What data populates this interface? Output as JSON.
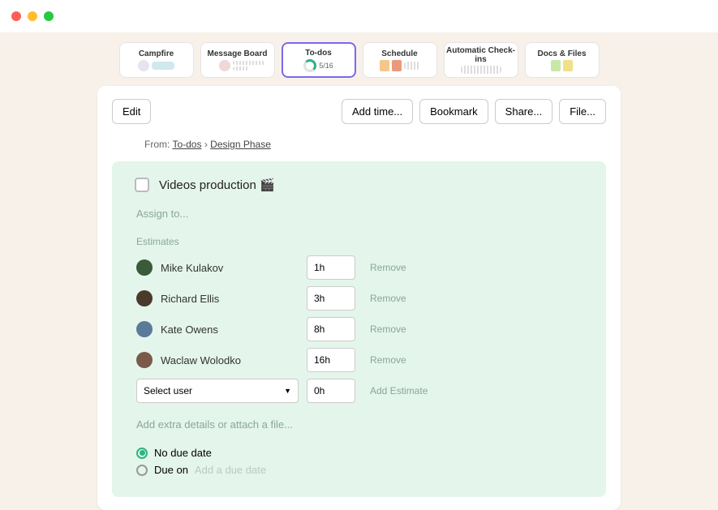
{
  "nav": {
    "tabs": [
      {
        "label": "Campfire"
      },
      {
        "label": "Message Board"
      },
      {
        "label": "To-dos",
        "count": "5/16",
        "active": true
      },
      {
        "label": "Schedule"
      },
      {
        "label": "Automatic Check-ins"
      },
      {
        "label": "Docs & Files"
      }
    ]
  },
  "toolbar": {
    "edit": "Edit",
    "add_time": "Add time...",
    "bookmark": "Bookmark",
    "share": "Share...",
    "file": "File..."
  },
  "breadcrumb": {
    "from": "From: ",
    "link1": "To-dos",
    "sep": " › ",
    "link2": "Design Phase"
  },
  "todo": {
    "title": "Videos production 🎬",
    "assign_placeholder": "Assign to...",
    "estimates_label": "Estimates",
    "estimates": [
      {
        "name": "Mike Kulakov",
        "time": "1h",
        "avatar": "#3a5a3a"
      },
      {
        "name": "Richard Ellis",
        "time": "3h",
        "avatar": "#4a3a2a"
      },
      {
        "name": "Kate Owens",
        "time": "8h",
        "avatar": "#5a7a9a"
      },
      {
        "name": "Waclaw Wolodko",
        "time": "16h",
        "avatar": "#7a5a4a"
      }
    ],
    "remove_label": "Remove",
    "select_user": "Select user",
    "default_time": "0h",
    "add_estimate": "Add Estimate",
    "details_placeholder": "Add extra details or attach a file...",
    "no_due": "No due date",
    "due_on": "Due on",
    "due_placeholder": "Add a due date"
  }
}
